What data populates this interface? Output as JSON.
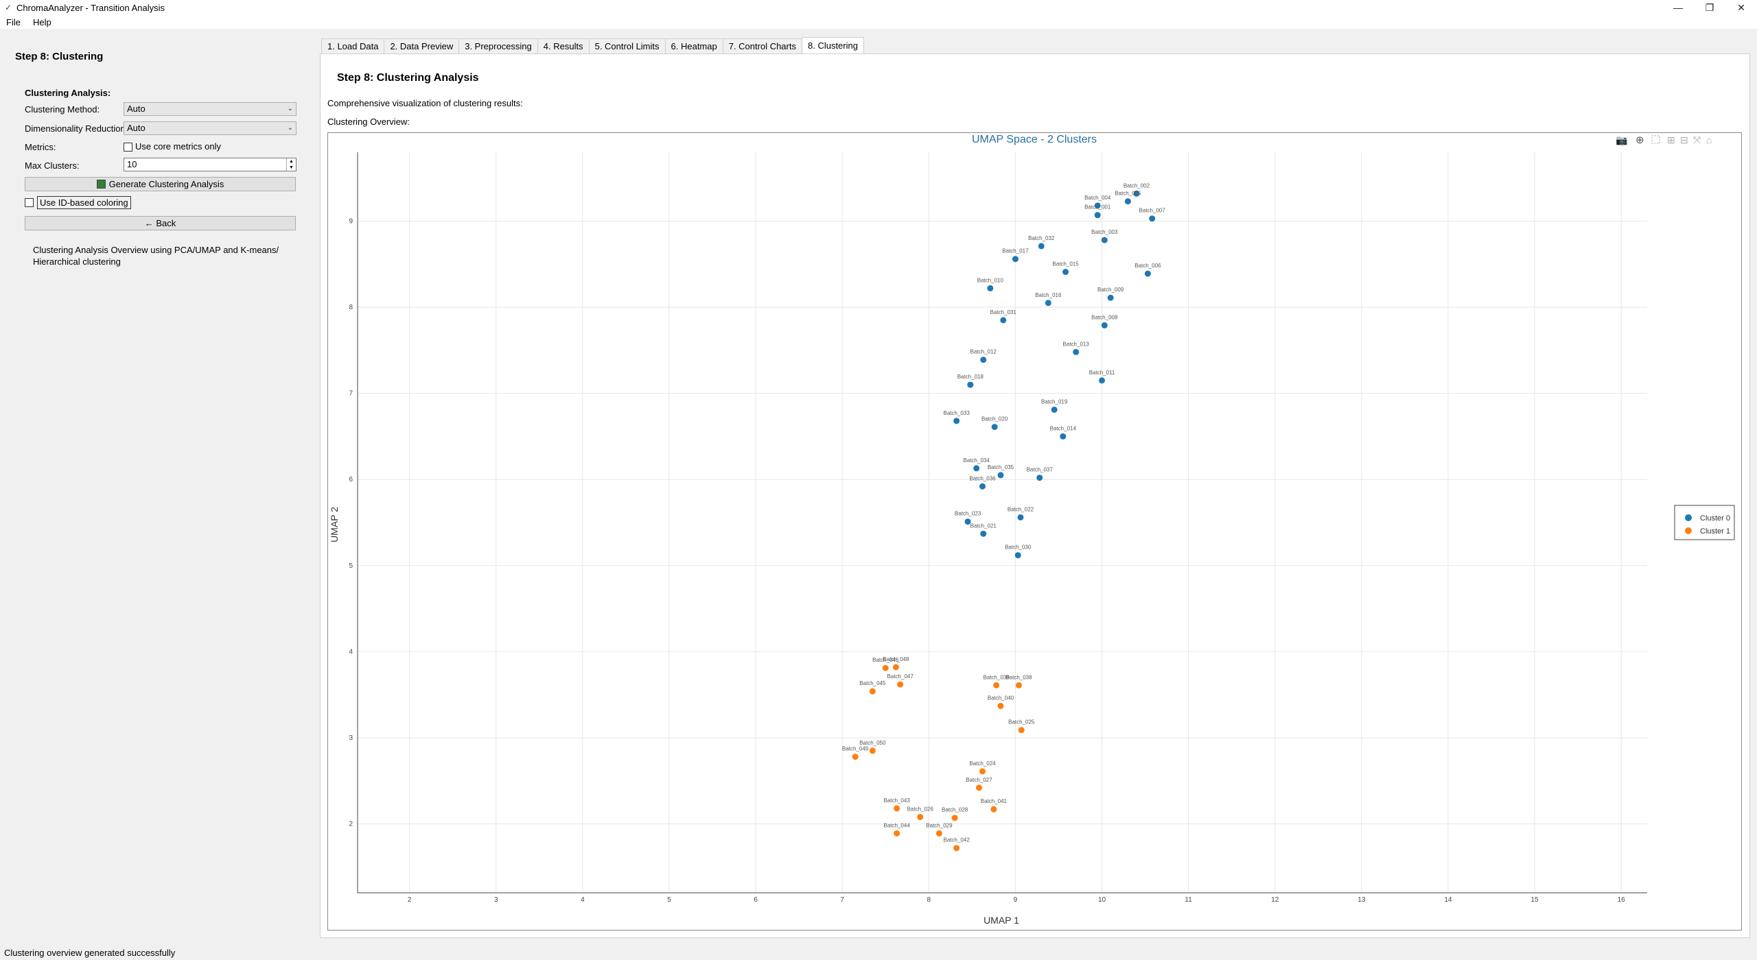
{
  "window": {
    "title": "ChromaAnalyzer - Transition Analysis"
  },
  "menu": {
    "file": "File",
    "help": "Help"
  },
  "left": {
    "step_title": "Step 8: Clustering",
    "section_title": "Clustering Analysis:",
    "method_label": "Clustering Method:",
    "method_value": "Auto",
    "dimred_label": "Dimensionality Reduction:",
    "dimred_value": "Auto",
    "metrics_label": "Metrics:",
    "metrics_checkbox": "Use core metrics only",
    "maxclusters_label": "Max Clusters:",
    "maxclusters_value": "10",
    "generate_button": "Generate Clustering Analysis",
    "id_coloring": "Use ID-based coloring",
    "back_button": "← Back",
    "info": "Clustering Analysis Overview using PCA/UMAP and K-means/ Hierarchical clustering"
  },
  "tabs": [
    "1. Load Data",
    "2. Data Preview",
    "3. Preprocessing",
    "4. Results",
    "5. Control Limits",
    "6. Heatmap",
    "7. Control Charts",
    "8. Clustering"
  ],
  "main": {
    "title": "Step 8: Clustering Analysis",
    "description": "Comprehensive visualization of clustering results:",
    "overview_label": "Clustering Overview:"
  },
  "status": "Clustering overview generated successfully",
  "colors": {
    "cluster0": "#1f77b4",
    "cluster1": "#ff7f0e",
    "title": "#2a6fa0"
  },
  "chart_data": {
    "type": "scatter",
    "title": "UMAP Space - 2 Clusters",
    "xlabel": "UMAP 1",
    "ylabel": "UMAP 2",
    "xlim": [
      1.4,
      16.3
    ],
    "ylim": [
      1.2,
      9.8
    ],
    "xticks": [
      2,
      3,
      4,
      5,
      6,
      7,
      8,
      9,
      10,
      11,
      12,
      13,
      14,
      15,
      16
    ],
    "yticks": [
      2,
      3,
      4,
      5,
      6,
      7,
      8,
      9
    ],
    "legend_position": "right",
    "series": [
      {
        "name": "Cluster 0",
        "points": [
          {
            "label": "Batch_002",
            "x": 10.4,
            "y": 9.32
          },
          {
            "label": "Batch_005",
            "x": 10.3,
            "y": 9.23
          },
          {
            "label": "Batch_004",
            "x": 9.95,
            "y": 9.18
          },
          {
            "label": "Batch_001",
            "x": 9.95,
            "y": 9.07
          },
          {
            "label": "Batch_007",
            "x": 10.58,
            "y": 9.03
          },
          {
            "label": "Batch_003",
            "x": 10.03,
            "y": 8.78
          },
          {
            "label": "Batch_032",
            "x": 9.3,
            "y": 8.71
          },
          {
            "label": "Batch_017",
            "x": 9.0,
            "y": 8.56
          },
          {
            "label": "Batch_015",
            "x": 9.58,
            "y": 8.41
          },
          {
            "label": "Batch_006",
            "x": 10.53,
            "y": 8.39
          },
          {
            "label": "Batch_010",
            "x": 8.71,
            "y": 8.22
          },
          {
            "label": "Batch_009",
            "x": 10.1,
            "y": 8.11
          },
          {
            "label": "Batch_016",
            "x": 9.38,
            "y": 8.05
          },
          {
            "label": "Batch_031",
            "x": 8.86,
            "y": 7.85
          },
          {
            "label": "Batch_008",
            "x": 10.03,
            "y": 7.79
          },
          {
            "label": "Batch_013",
            "x": 9.7,
            "y": 7.48
          },
          {
            "label": "Batch_012",
            "x": 8.63,
            "y": 7.39
          },
          {
            "label": "Batch_011",
            "x": 10.0,
            "y": 7.15
          },
          {
            "label": "Batch_018",
            "x": 8.48,
            "y": 7.1
          },
          {
            "label": "Batch_019",
            "x": 9.45,
            "y": 6.81
          },
          {
            "label": "Batch_033",
            "x": 8.32,
            "y": 6.68
          },
          {
            "label": "Batch_020",
            "x": 8.76,
            "y": 6.61
          },
          {
            "label": "Batch_014",
            "x": 9.55,
            "y": 6.5
          },
          {
            "label": "Batch_034",
            "x": 8.55,
            "y": 6.13
          },
          {
            "label": "Batch_035",
            "x": 8.83,
            "y": 6.05
          },
          {
            "label": "Batch_037",
            "x": 9.28,
            "y": 6.02
          },
          {
            "label": "Batch_036",
            "x": 8.62,
            "y": 5.92
          },
          {
            "label": "Batch_022",
            "x": 9.06,
            "y": 5.56
          },
          {
            "label": "Batch_023",
            "x": 8.45,
            "y": 5.51
          },
          {
            "label": "Batch_021",
            "x": 8.63,
            "y": 5.37
          },
          {
            "label": "Batch_030",
            "x": 9.03,
            "y": 5.12
          }
        ]
      },
      {
        "name": "Cluster 1",
        "points": [
          {
            "label": "Batch_046",
            "x": 7.5,
            "y": 3.81
          },
          {
            "label": "Batch_048",
            "x": 7.62,
            "y": 3.82
          },
          {
            "label": "Batch_047",
            "x": 7.67,
            "y": 3.62
          },
          {
            "label": "Batch_045",
            "x": 7.35,
            "y": 3.54
          },
          {
            "label": "Batch_039",
            "x": 8.78,
            "y": 3.61
          },
          {
            "label": "Batch_038",
            "x": 9.04,
            "y": 3.61
          },
          {
            "label": "Batch_040",
            "x": 8.83,
            "y": 3.37
          },
          {
            "label": "Batch_025",
            "x": 9.07,
            "y": 3.09
          },
          {
            "label": "Batch_050",
            "x": 7.35,
            "y": 2.85
          },
          {
            "label": "Batch_049",
            "x": 7.15,
            "y": 2.78
          },
          {
            "label": "Batch_024",
            "x": 8.62,
            "y": 2.61
          },
          {
            "label": "Batch_027",
            "x": 8.58,
            "y": 2.42
          },
          {
            "label": "Batch_043",
            "x": 7.63,
            "y": 2.18
          },
          {
            "label": "Batch_026",
            "x": 7.9,
            "y": 2.08
          },
          {
            "label": "Batch_028",
            "x": 8.3,
            "y": 2.07
          },
          {
            "label": "Batch_041",
            "x": 8.75,
            "y": 2.17
          },
          {
            "label": "Batch_044",
            "x": 7.63,
            "y": 1.89
          },
          {
            "label": "Batch_029",
            "x": 8.12,
            "y": 1.89
          },
          {
            "label": "Batch_042",
            "x": 8.32,
            "y": 1.72
          }
        ]
      }
    ]
  }
}
